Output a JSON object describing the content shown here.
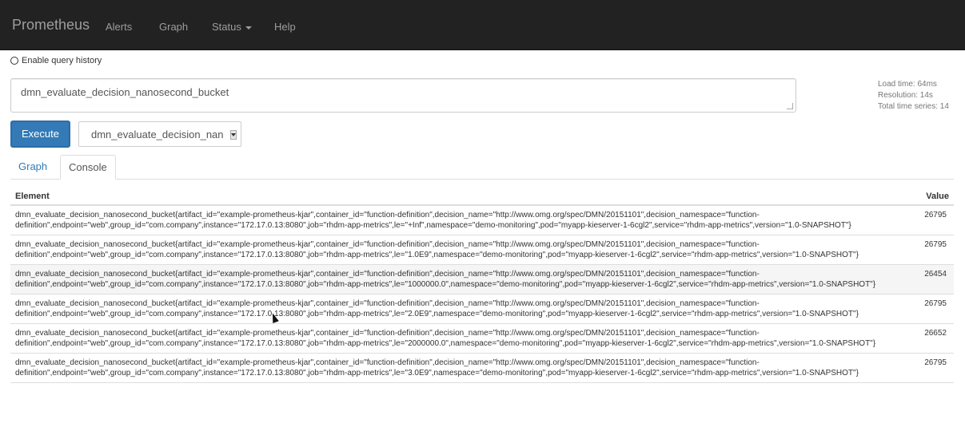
{
  "navbar": {
    "brand": "Prometheus",
    "items": [
      {
        "label": "Alerts"
      },
      {
        "label": "Graph"
      },
      {
        "label": "Status"
      },
      {
        "label": "Help"
      }
    ]
  },
  "query_history": {
    "label": "Enable query history"
  },
  "expression": {
    "value": "dmn_evaluate_decision_nanosecond_bucket"
  },
  "stats": {
    "load_time": "Load time: 64ms",
    "resolution": "Resolution: 14s",
    "total_series": "Total time series: 14"
  },
  "execute": {
    "label": "Execute"
  },
  "metric_selector": {
    "value": "dmn_evaluate_decision_nanosecond_bucket"
  },
  "tabs": [
    {
      "label": "Graph",
      "active": false
    },
    {
      "label": "Console",
      "active": true
    }
  ],
  "table": {
    "headers": {
      "element": "Element",
      "value": "Value"
    },
    "rows": [
      {
        "element": "dmn_evaluate_decision_nanosecond_bucket{artifact_id=\"example-prometheus-kjar\",container_id=\"function-definition\",decision_name=\"http://www.omg.org/spec/DMN/20151101\",decision_namespace=\"function-definition\",endpoint=\"web\",group_id=\"com.company\",instance=\"172.17.0.13:8080\",job=\"rhdm-app-metrics\",le=\"+Inf\",namespace=\"demo-monitoring\",pod=\"myapp-kieserver-1-6cgl2\",service=\"rhdm-app-metrics\",version=\"1.0-SNAPSHOT\"}",
        "value": "26795"
      },
      {
        "element": "dmn_evaluate_decision_nanosecond_bucket{artifact_id=\"example-prometheus-kjar\",container_id=\"function-definition\",decision_name=\"http://www.omg.org/spec/DMN/20151101\",decision_namespace=\"function-definition\",endpoint=\"web\",group_id=\"com.company\",instance=\"172.17.0.13:8080\",job=\"rhdm-app-metrics\",le=\"1.0E9\",namespace=\"demo-monitoring\",pod=\"myapp-kieserver-1-6cgl2\",service=\"rhdm-app-metrics\",version=\"1.0-SNAPSHOT\"}",
        "value": "26795"
      },
      {
        "element": "dmn_evaluate_decision_nanosecond_bucket{artifact_id=\"example-prometheus-kjar\",container_id=\"function-definition\",decision_name=\"http://www.omg.org/spec/DMN/20151101\",decision_namespace=\"function-definition\",endpoint=\"web\",group_id=\"com.company\",instance=\"172.17.0.13:8080\",job=\"rhdm-app-metrics\",le=\"1000000.0\",namespace=\"demo-monitoring\",pod=\"myapp-kieserver-1-6cgl2\",service=\"rhdm-app-metrics\",version=\"1.0-SNAPSHOT\"}",
        "value": "26454"
      },
      {
        "element": "dmn_evaluate_decision_nanosecond_bucket{artifact_id=\"example-prometheus-kjar\",container_id=\"function-definition\",decision_name=\"http://www.omg.org/spec/DMN/20151101\",decision_namespace=\"function-definition\",endpoint=\"web\",group_id=\"com.company\",instance=\"172.17.0.13:8080\",job=\"rhdm-app-metrics\",le=\"2.0E9\",namespace=\"demo-monitoring\",pod=\"myapp-kieserver-1-6cgl2\",service=\"rhdm-app-metrics\",version=\"1.0-SNAPSHOT\"}",
        "value": "26795"
      },
      {
        "element": "dmn_evaluate_decision_nanosecond_bucket{artifact_id=\"example-prometheus-kjar\",container_id=\"function-definition\",decision_name=\"http://www.omg.org/spec/DMN/20151101\",decision_namespace=\"function-definition\",endpoint=\"web\",group_id=\"com.company\",instance=\"172.17.0.13:8080\",job=\"rhdm-app-metrics\",le=\"2000000.0\",namespace=\"demo-monitoring\",pod=\"myapp-kieserver-1-6cgl2\",service=\"rhdm-app-metrics\",version=\"1.0-SNAPSHOT\"}",
        "value": "26652"
      },
      {
        "element": "dmn_evaluate_decision_nanosecond_bucket{artifact_id=\"example-prometheus-kjar\",container_id=\"function-definition\",decision_name=\"http://www.omg.org/spec/DMN/20151101\",decision_namespace=\"function-definition\",endpoint=\"web\",group_id=\"com.company\",instance=\"172.17.0.13:8080\",job=\"rhdm-app-metrics\",le=\"3.0E9\",namespace=\"demo-monitoring\",pod=\"myapp-kieserver-1-6cgl2\",service=\"rhdm-app-metrics\",version=\"1.0-SNAPSHOT\"}",
        "value": "26795"
      }
    ]
  },
  "colors": {
    "navbar_bg": "#222222",
    "primary": "#337ab7",
    "link": "#337ab7"
  }
}
